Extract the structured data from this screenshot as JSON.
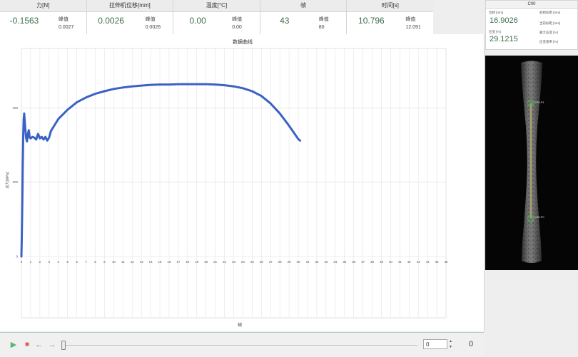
{
  "metrics": [
    {
      "header": "力[N]",
      "value": "-0.1563",
      "peak_label": "峰值",
      "peak": "0.0027"
    },
    {
      "header": "拉伸机位移[mm]",
      "value": "0.0026",
      "peak_label": "峰值",
      "peak": "0.0026"
    },
    {
      "header": "温度[°C]",
      "value": "0.00",
      "peak_label": "峰值",
      "peak": "0.00"
    },
    {
      "header": "帧",
      "value": "43",
      "peak_label": "峰值",
      "peak": "80"
    },
    {
      "header": "时间[s]",
      "value": "10.796",
      "peak_label": "峰值",
      "peak": "12.091"
    }
  ],
  "chart_data": {
    "type": "line",
    "title": "数据曲线",
    "xlabel": "帧",
    "ylabel": "应力[MPa]",
    "xlim": [
      0,
      46
    ],
    "ylim": [
      0,
      560
    ],
    "xticks": [
      "0",
      "1",
      "2",
      "3",
      "4",
      "5",
      "6",
      "7",
      "8",
      "9",
      "10",
      "11",
      "12",
      "13",
      "14",
      "15",
      "16",
      "17",
      "18",
      "19",
      "20",
      "21",
      "22",
      "23",
      "24",
      "25",
      "26",
      "27",
      "28",
      "29",
      "30",
      "31",
      "32",
      "33",
      "34",
      "35",
      "36",
      "37",
      "38",
      "39",
      "40",
      "41",
      "42",
      "43",
      "44",
      "45",
      "46"
    ],
    "yticks": [
      "0",
      "200",
      "400"
    ],
    "grid": true,
    "series": [
      {
        "color": "#3a62c4",
        "x": [
          0.0,
          0.05,
          0.1,
          0.15,
          0.2,
          0.25,
          0.3,
          0.4,
          0.5,
          0.6,
          0.7,
          0.8,
          0.9,
          1.0,
          1.2,
          1.4,
          1.6,
          1.8,
          2.0,
          2.2,
          2.4,
          2.6,
          2.8,
          3.0,
          3.2,
          3.5,
          4,
          5,
          6,
          7,
          8,
          9,
          10,
          11,
          12,
          13,
          14,
          15,
          16,
          17,
          18,
          19,
          20,
          21,
          22,
          23,
          24,
          25,
          26,
          27,
          28,
          29,
          30,
          30.2
        ],
        "y": [
          0,
          60,
          150,
          250,
          330,
          370,
          385,
          350,
          320,
          310,
          330,
          340,
          320,
          318,
          322,
          320,
          315,
          330,
          318,
          322,
          315,
          322,
          312,
          320,
          338,
          350,
          370,
          395,
          415,
          428,
          438,
          445,
          451,
          455,
          458,
          460,
          462,
          463,
          463,
          464,
          464,
          464,
          464,
          463,
          461,
          458,
          453,
          445,
          432,
          412,
          385,
          352,
          316,
          312
        ]
      }
    ]
  },
  "player": {
    "frame_value": "0",
    "frame_count": "0",
    "spin_up": "▲",
    "spin_down": "▼"
  },
  "right_panel": {
    "camera_title": "C00",
    "displacement_label": "位移 [mm]",
    "displacement_value": "16.9026",
    "initial_gauge_label": "初始标距 [mm]",
    "current_gauge_label": "当前标距 [mm]",
    "strain_label": "应变 [%]",
    "strain_value": "29.1215",
    "max_strain_label": "最大应变 [%]",
    "strain_rate_label": "应变速率 [%]",
    "marker_top_label": "C00-P1",
    "marker_bottom_label": "C00-P0"
  },
  "colors": {
    "value_green": "#3c6e4a",
    "curve_blue": "#3a62c4",
    "play_green": "#56b870",
    "stop_red": "#e25a5a"
  }
}
